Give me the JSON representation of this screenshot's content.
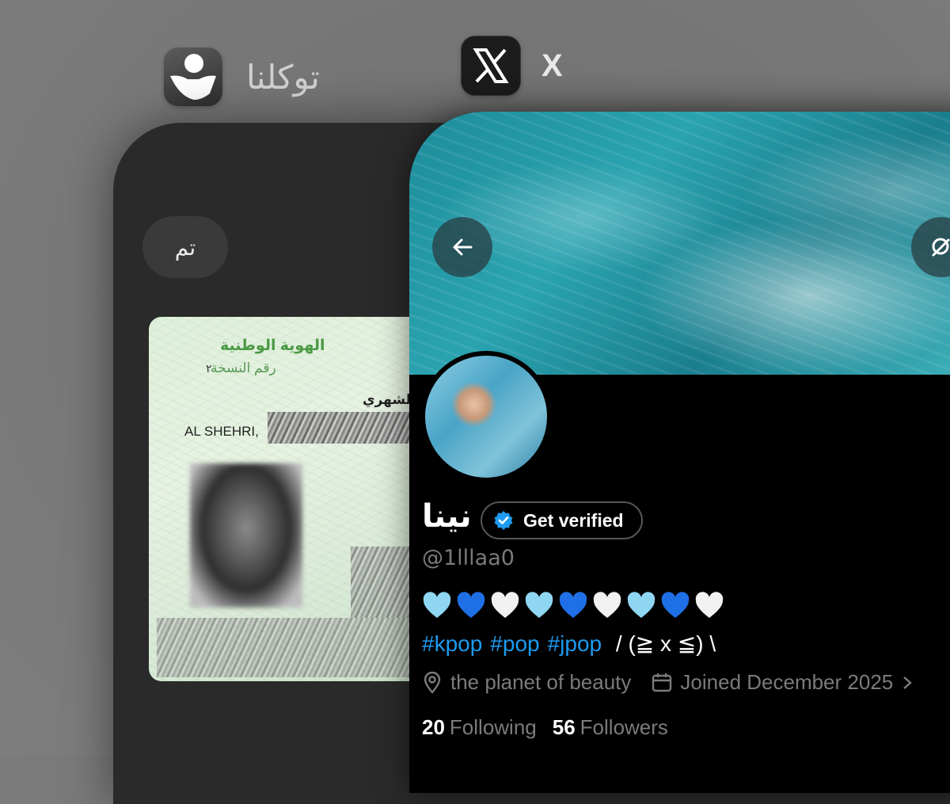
{
  "app_switcher": {
    "apps": [
      {
        "name": "توكلنا",
        "icon": "tawakkalna-icon"
      },
      {
        "name": "X",
        "icon": "x-logo-icon"
      }
    ]
  },
  "tawakkalna": {
    "done_label": "تم",
    "id_card": {
      "title": "الهوية الوطنية",
      "version_label": "رقم النسخة",
      "version_number": "٢",
      "name_ar": "الشهري",
      "name_en": "AL SHEHRI,"
    }
  },
  "x_profile": {
    "display_name": "نينا",
    "verify_label": "Get verified",
    "handle": "@1lllaa0",
    "hearts": [
      "light-blue",
      "blue",
      "white",
      "light-blue",
      "blue",
      "white",
      "light-blue",
      "blue",
      "white"
    ],
    "hashtags": [
      "#kpop",
      "#pop",
      "#jpop"
    ],
    "bio_suffix": "/ (≧ x ≦) \\",
    "location": "the planet of beauty",
    "joined": "Joined December 2025",
    "following_count": "20",
    "following_label": "Following",
    "followers_count": "56",
    "followers_label": "Followers",
    "colors": {
      "accent": "#1d9bf0",
      "muted": "#7b7b7b",
      "verified": "#1d9bf0"
    }
  }
}
